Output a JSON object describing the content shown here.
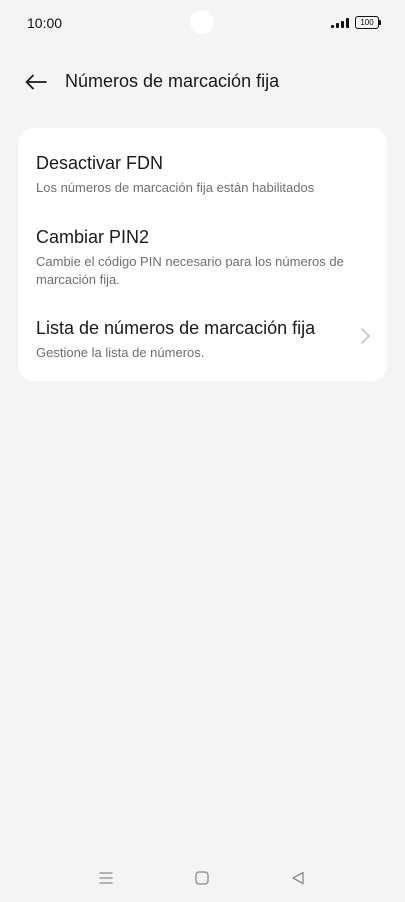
{
  "status_bar": {
    "time": "10:00",
    "battery": "100"
  },
  "header": {
    "title": "Números de marcación fija"
  },
  "settings": {
    "items": [
      {
        "title": "Desactivar FDN",
        "subtitle": "Los números de marcación fija están habilitados"
      },
      {
        "title": "Cambiar PIN2",
        "subtitle": "Cambie el código PIN necesario para los números de marcación fija."
      },
      {
        "title": "Lista de números de marcación fija",
        "subtitle": "Gestione la lista de números."
      }
    ]
  },
  "icons": {
    "back": "arrow-left-icon",
    "chevron": "chevron-right-icon",
    "nav_menu": "menu-icon",
    "nav_home": "home-square-icon",
    "nav_back": "triangle-back-icon"
  }
}
